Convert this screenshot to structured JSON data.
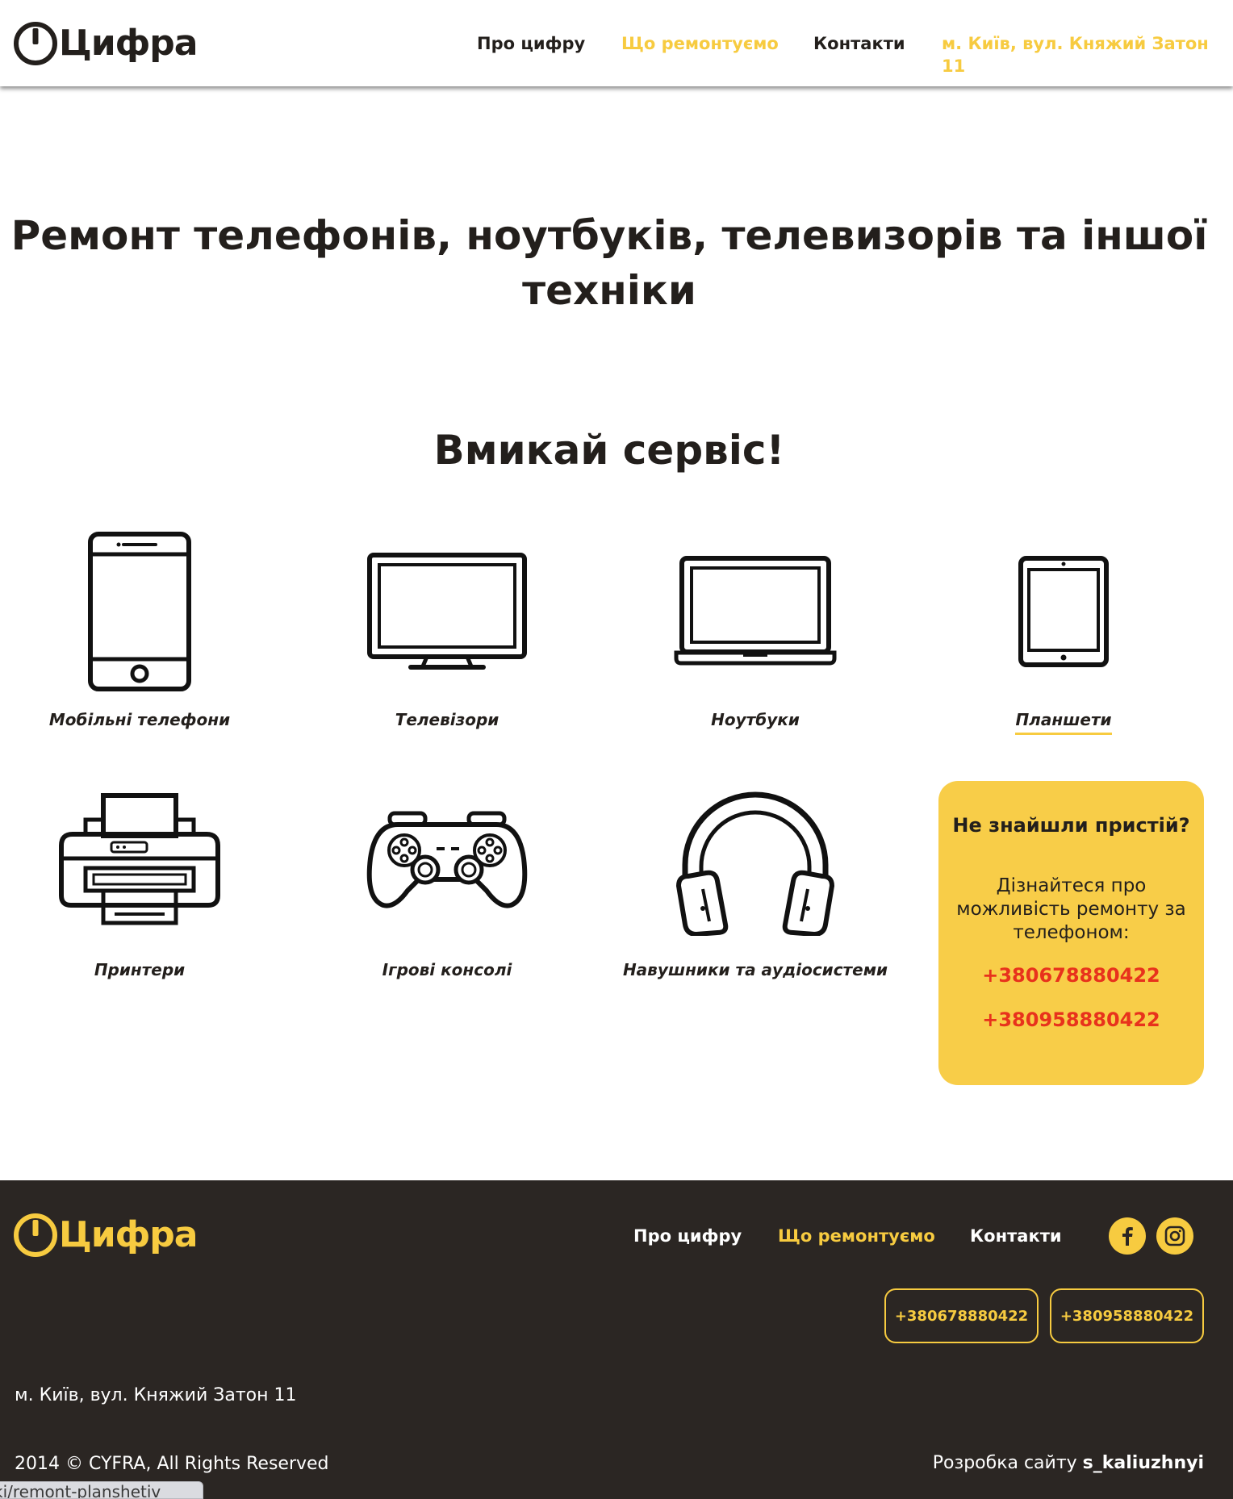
{
  "header": {
    "logo_text": "Цифра",
    "nav": [
      {
        "label": "Про цифру"
      },
      {
        "label": "Що ремонтуємо"
      },
      {
        "label": "Контакти"
      },
      {
        "label": "м. Київ, вул. Княжий Затон 11"
      }
    ]
  },
  "hero": {
    "title_line1": "Ремонт телефонів, ноутбуків, телевизорів та іншої",
    "title_line2": "техніки",
    "subtitle": "Вмикай сервіс!"
  },
  "devices": [
    {
      "label": "Мобільні телефони",
      "icon": "smartphone-icon"
    },
    {
      "label": "Телевізори",
      "icon": "tv-icon"
    },
    {
      "label": "Ноутбуки",
      "icon": "laptop-icon"
    },
    {
      "label": "Планшети",
      "icon": "tablet-icon"
    },
    {
      "label": "Принтери",
      "icon": "printer-icon"
    },
    {
      "label": "Ігрові консолі",
      "icon": "gamepad-icon"
    },
    {
      "label": "Навушники та аудіосистеми",
      "icon": "headphones-icon"
    }
  ],
  "card": {
    "title": "Не знайшли пристій?",
    "text": "Дізнайтеся про можливість ремонту за телефоном:",
    "phone1": "+380678880422",
    "phone2": "+380958880422"
  },
  "footer": {
    "logo_text": "Цифра",
    "nav": [
      {
        "label": "Про цифру"
      },
      {
        "label": "Що ремонтуємо"
      },
      {
        "label": "Контакти"
      }
    ],
    "social": [
      "facebook-icon",
      "instagram-icon"
    ],
    "phone1": "+380678880422",
    "phone2": "+380958880422",
    "address": "м. Київ, вул. Княжий Затон 11",
    "copyright": "2014 © CYFRA, All Rights Reserved",
    "dev_prefix": "Розробка сайту",
    "dev_name": "s_kaliuzhnyi"
  },
  "status_bar": {
    "url": "ki/remont-planshetiv"
  },
  "colors": {
    "accent": "#f7cb40",
    "card_bg": "#f8cd48",
    "phone_red": "#e8321c",
    "dark": "#231f1c",
    "footer_bg": "#2b2623"
  }
}
